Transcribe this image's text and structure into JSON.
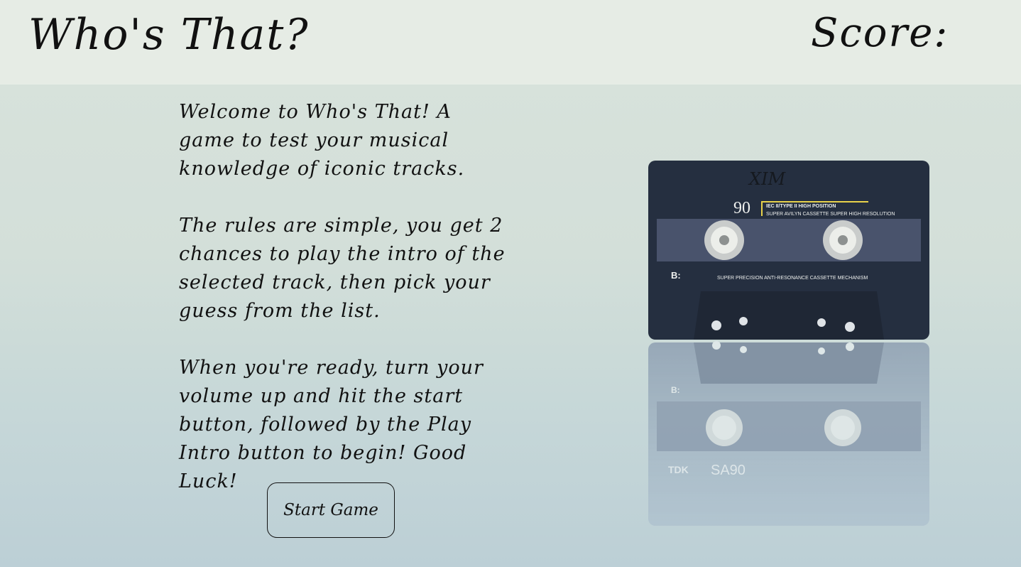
{
  "header": {
    "title": "Who's That?",
    "score_label": "Score:",
    "score_value": ""
  },
  "intro": {
    "paragraphs": [
      "Welcome to Who's That! A game to test your musical knowledge of iconic tracks.",
      "The rules are simple, you get 2 chances to play the intro of the selected track, then pick your guess from the list.",
      "When you're ready, turn your volume up and hit the start button, followed by the Play Intro button to begin! Good Luck!"
    ]
  },
  "start_button": {
    "label": "Start Game"
  },
  "cassette": {
    "handwriting": "XIM",
    "length": "90",
    "type_line": "IEC II/TYPE II HIGH POSITION",
    "tagline": "SUPER AVILYN CASSETTE SUPER HIGH RESOLUTION",
    "side": "B:",
    "mechanism": "SUPER PRECISION ANTI-RESONANCE CASSETTE MECHANISM",
    "reflection_brand": "TDK",
    "reflection_model": "SA90"
  },
  "colors": {
    "header_bg": "#e6ece5",
    "text": "#111111",
    "cassette_body": "#252f40",
    "cassette_label_accent": "#e8d24a"
  }
}
